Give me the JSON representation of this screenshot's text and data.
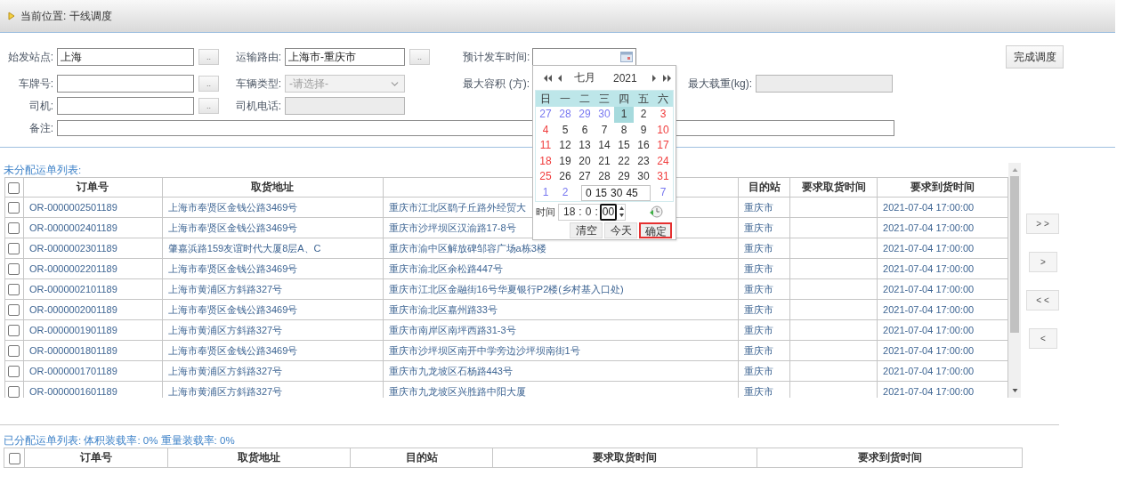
{
  "breadcrumb": "当前位置: 干线调度",
  "form": {
    "origin": {
      "label": "始发站点:",
      "value": "上海",
      "button": ".."
    },
    "route": {
      "label": "运输路由:",
      "value": "上海市-重庆市",
      "button": ".."
    },
    "depart_time": {
      "label": "预计发车时间:"
    },
    "plate": {
      "label": "车牌号:",
      "button": ".."
    },
    "vehicle_type": {
      "label": "车辆类型:",
      "placeholder": "-请选择-",
      "disabled": true
    },
    "max_volume": {
      "label": "最大容积 (方):"
    },
    "max_weight": {
      "label": "最大载重(kg):",
      "disabled": true
    },
    "driver": {
      "label": "司机:",
      "button": ".."
    },
    "driver_phone": {
      "label": "司机电话:",
      "disabled": true
    },
    "remark": {
      "label": "备注:"
    },
    "finish_button": "完成调度"
  },
  "calendar": {
    "month": "七月",
    "year": "2021",
    "weekdays": [
      "日",
      "一",
      "二",
      "三",
      "四",
      "五",
      "六"
    ],
    "weeks": [
      [
        {
          "day": "27",
          "kind": "other",
          "selected": false
        },
        {
          "day": "28",
          "kind": "other",
          "selected": false
        },
        {
          "day": "29",
          "kind": "other",
          "selected": false
        },
        {
          "day": "30",
          "kind": "other",
          "selected": false
        },
        {
          "day": "1",
          "kind": "weekday",
          "selected": true
        },
        {
          "day": "2",
          "kind": "weekday",
          "selected": false
        },
        {
          "day": "3",
          "kind": "weekend",
          "selected": false
        }
      ],
      [
        {
          "day": "4",
          "kind": "weekend",
          "selected": false
        },
        {
          "day": "5",
          "kind": "weekday",
          "selected": false
        },
        {
          "day": "6",
          "kind": "weekday",
          "selected": false
        },
        {
          "day": "7",
          "kind": "weekday",
          "selected": false
        },
        {
          "day": "8",
          "kind": "weekday",
          "selected": false
        },
        {
          "day": "9",
          "kind": "weekday",
          "selected": false
        },
        {
          "day": "10",
          "kind": "weekend",
          "selected": false
        }
      ],
      [
        {
          "day": "11",
          "kind": "weekend",
          "selected": false
        },
        {
          "day": "12",
          "kind": "weekday",
          "selected": false
        },
        {
          "day": "13",
          "kind": "weekday",
          "selected": false
        },
        {
          "day": "14",
          "kind": "weekday",
          "selected": false
        },
        {
          "day": "15",
          "kind": "weekday",
          "selected": false
        },
        {
          "day": "16",
          "kind": "weekday",
          "selected": false
        },
        {
          "day": "17",
          "kind": "weekend",
          "selected": false
        }
      ],
      [
        {
          "day": "18",
          "kind": "weekend",
          "selected": false
        },
        {
          "day": "19",
          "kind": "weekday",
          "selected": false
        },
        {
          "day": "20",
          "kind": "weekday",
          "selected": false
        },
        {
          "day": "21",
          "kind": "weekday",
          "selected": false
        },
        {
          "day": "22",
          "kind": "weekday",
          "selected": false
        },
        {
          "day": "23",
          "kind": "weekday",
          "selected": false
        },
        {
          "day": "24",
          "kind": "weekend",
          "selected": false
        }
      ],
      [
        {
          "day": "25",
          "kind": "weekend",
          "selected": false
        },
        {
          "day": "26",
          "kind": "weekday",
          "selected": false
        },
        {
          "day": "27",
          "kind": "weekday",
          "selected": false
        },
        {
          "day": "28",
          "kind": "weekday",
          "selected": false
        },
        {
          "day": "29",
          "kind": "weekday",
          "selected": false
        },
        {
          "day": "30",
          "kind": "weekday",
          "selected": false
        },
        {
          "day": "31",
          "kind": "weekend",
          "selected": false
        }
      ],
      [
        {
          "day": "1",
          "kind": "other",
          "selected": false
        },
        {
          "day": "2",
          "kind": "other",
          "selected": false
        },
        {
          "kind": "minutes",
          "options": [
            "0",
            "15",
            "30",
            "45"
          ]
        },
        {
          "day": "7",
          "kind": "other",
          "selected": false
        }
      ]
    ],
    "time": {
      "label": "时间",
      "hour": "18",
      "separator": ":",
      "minute": "0",
      "second": "00"
    },
    "buttons": [
      {
        "label": "清空",
        "highlighted": false
      },
      {
        "label": "今天",
        "highlighted": false
      },
      {
        "label": "确定",
        "highlighted": true
      }
    ]
  },
  "unassigned": {
    "title": "未分配运单列表:",
    "all_checked": false,
    "columns": [
      {
        "label": "订单号"
      },
      {
        "label": "取货地址"
      },
      {},
      {
        "label": "目的站"
      },
      {
        "label": "要求取货时间"
      },
      {
        "label": "要求到货时间"
      }
    ],
    "rows": [
      {
        "checked": false,
        "cells": [
          "OR-0000002501189",
          "上海市奉贤区金钱公路3469号",
          "重庆市江北区鹞子丘路外经贸大",
          "重庆市",
          "",
          "2021-07-04 17:00:00"
        ]
      },
      {
        "checked": false,
        "cells": [
          "OR-0000002401189",
          "上海市奉贤区金钱公路3469号",
          "重庆市沙坪坝区汉渝路17-8号",
          "重庆市",
          "",
          "2021-07-04 17:00:00"
        ]
      },
      {
        "checked": false,
        "cells": [
          "OR-0000002301189",
          "肇嘉浜路159友谊时代大厦8层A、C",
          "重庆市渝中区解放碑邹容广场a栋3楼",
          "重庆市",
          "",
          "2021-07-04 17:00:00"
        ]
      },
      {
        "checked": false,
        "cells": [
          "OR-0000002201189",
          "上海市奉贤区金钱公路3469号",
          "重庆市渝北区余松路447号",
          "重庆市",
          "",
          "2021-07-04 17:00:00"
        ]
      },
      {
        "checked": false,
        "cells": [
          "OR-0000002101189",
          "上海市黄浦区方斜路327号",
          "重庆市江北区金融街16号华夏银行P2楼(乡村基入口处)",
          "重庆市",
          "",
          "2021-07-04 17:00:00"
        ]
      },
      {
        "checked": false,
        "cells": [
          "OR-0000002001189",
          "上海市奉贤区金钱公路3469号",
          "重庆市渝北区嘉州路33号",
          "重庆市",
          "",
          "2021-07-04 17:00:00"
        ]
      },
      {
        "checked": false,
        "cells": [
          "OR-0000001901189",
          "上海市黄浦区方斜路327号",
          "重庆市南岸区南坪西路31-3号",
          "重庆市",
          "",
          "2021-07-04 17:00:00"
        ]
      },
      {
        "checked": false,
        "cells": [
          "OR-0000001801189",
          "上海市奉贤区金钱公路3469号",
          "重庆市沙坪坝区南开中学旁边沙坪坝南街1号",
          "重庆市",
          "",
          "2021-07-04 17:00:00"
        ]
      },
      {
        "checked": false,
        "cells": [
          "OR-0000001701189",
          "上海市黄浦区方斜路327号",
          "重庆市九龙坡区石杨路443号",
          "重庆市",
          "",
          "2021-07-04 17:00:00"
        ]
      },
      {
        "checked": false,
        "cells": [
          "OR-0000001601189",
          "上海市黄浦区方斜路327号",
          "重庆市九龙坡区兴胜路中阳大厦",
          "重庆市",
          "",
          "2021-07-04 17:00:00"
        ]
      }
    ]
  },
  "move_buttons": [
    "> >",
    ">",
    "< <",
    "<"
  ],
  "assigned": {
    "title": "已分配运单列表: 体积装载率: 0% 重量装载率: 0%",
    "all_checked": false,
    "columns": [
      {
        "label": "订单号"
      },
      {
        "label": "取货地址"
      },
      {
        "label": "目的站"
      },
      {
        "label": "要求取货时间"
      },
      {
        "label": "要求到货时间"
      }
    ]
  }
}
